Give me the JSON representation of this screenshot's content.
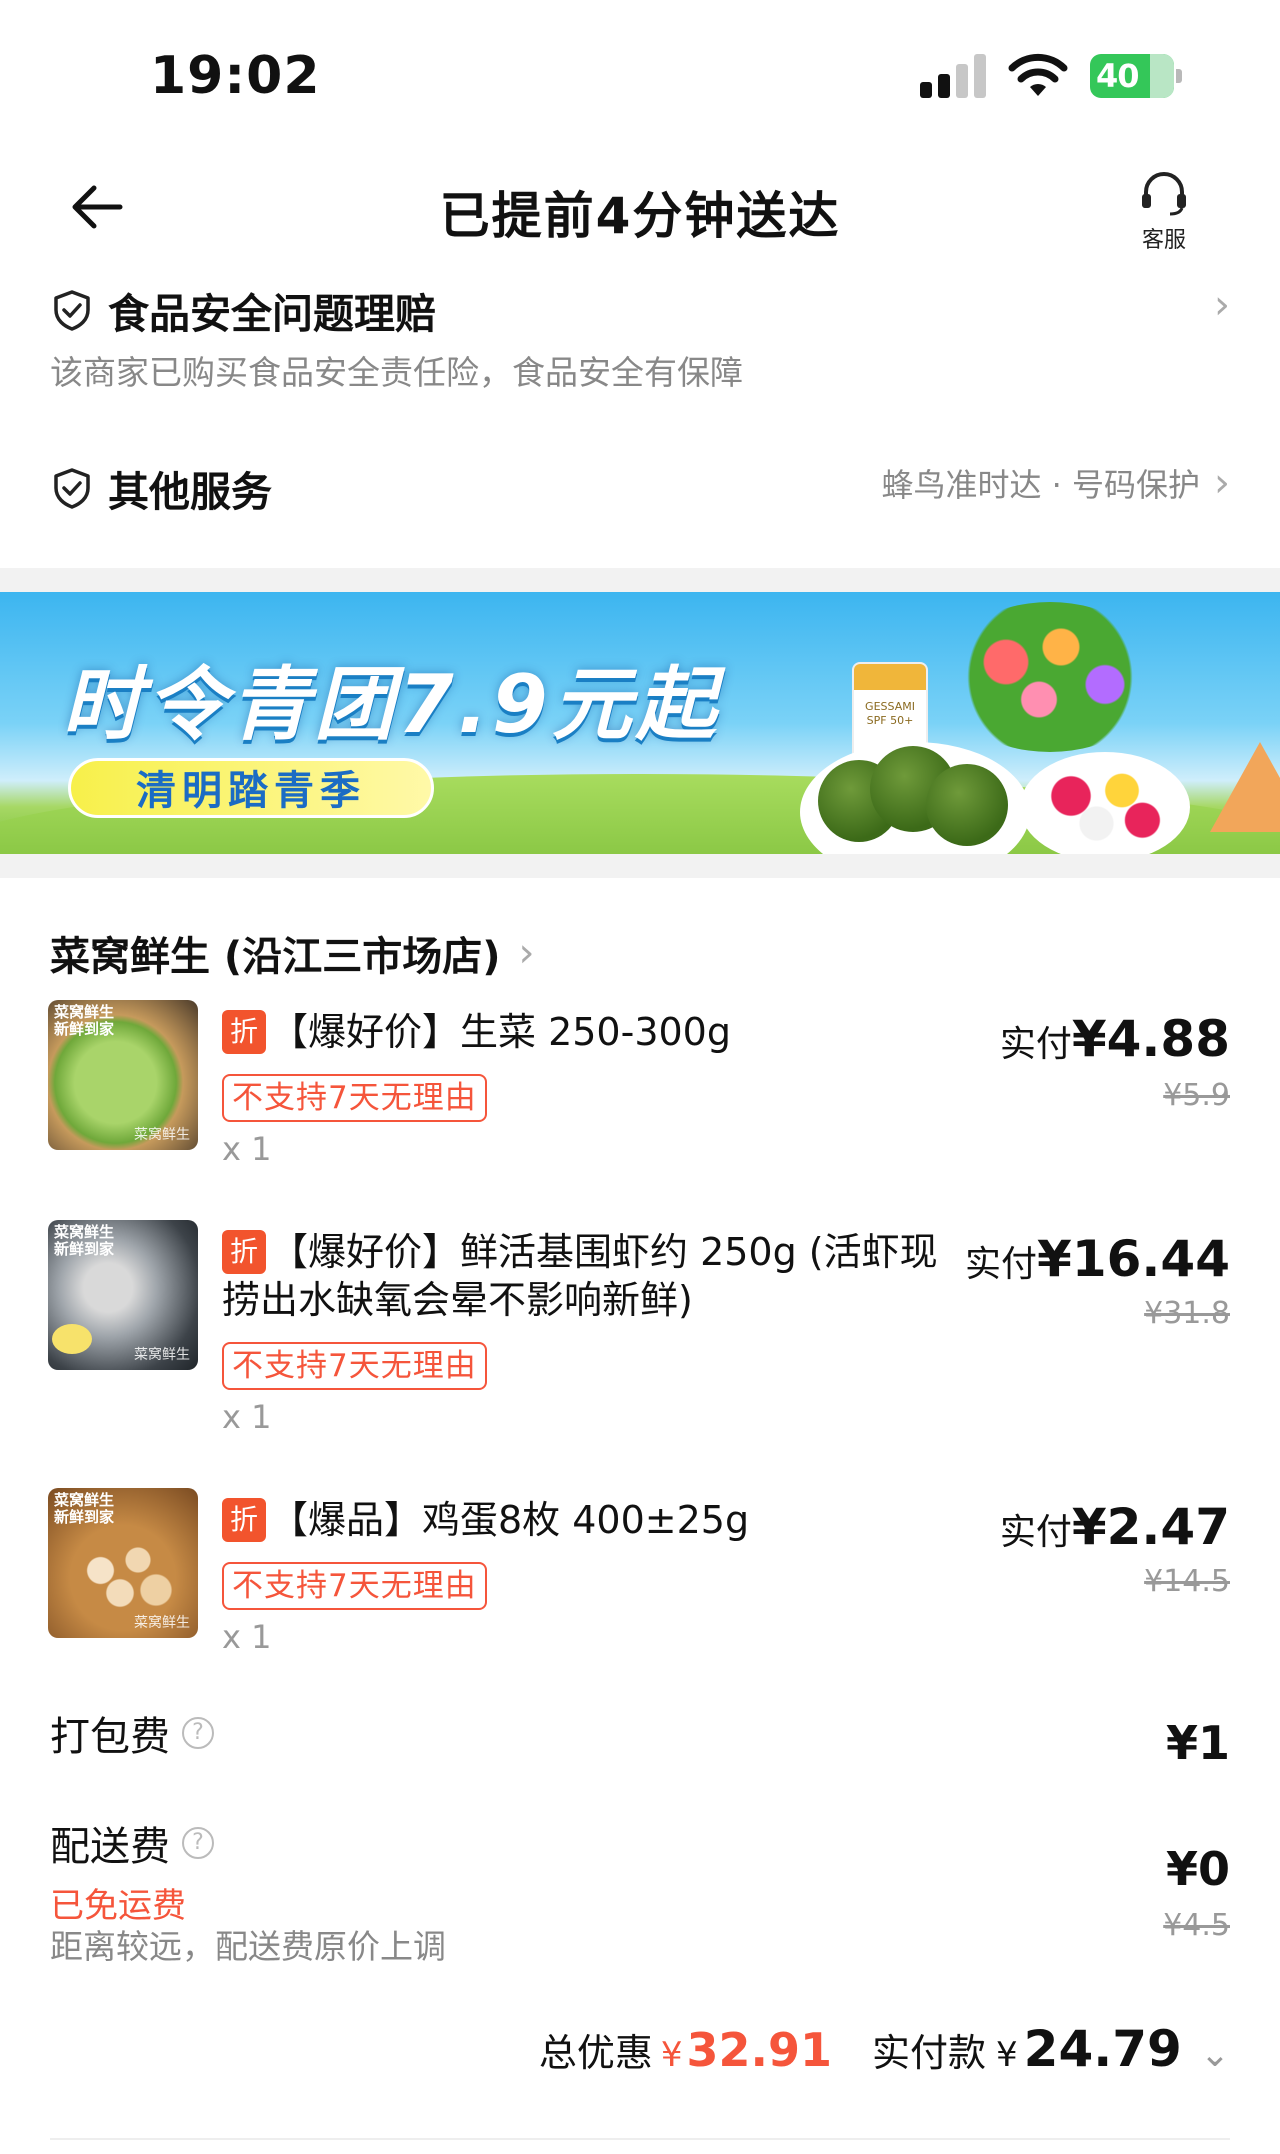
{
  "status_bar": {
    "time": "19:02",
    "battery": "40"
  },
  "header": {
    "title": "已提前4分钟送达",
    "service_label": "客服"
  },
  "food_safety": {
    "title": "食品安全问题理赔",
    "subtitle": "该商家已购买食品安全责任险，食品安全有保障"
  },
  "other_services": {
    "title": "其他服务",
    "detail": "蜂鸟准时达 · 号码保护"
  },
  "banner": {
    "title": "时令青团7.9元起",
    "subtitle": "清明踏青季",
    "product_label": "GESSAMI SPF 50+"
  },
  "store": {
    "name": "菜窝鲜生 (沿江三市场店)"
  },
  "items": [
    {
      "tag": "折",
      "name": "【爆好价】生菜 250-300g",
      "badge": "不支持7天无理由",
      "qty": "x 1",
      "paid_label": "实付",
      "paid_value": "¥4.88",
      "original_price": "¥5.9",
      "thumb_label": "菜窝鲜生\n新鲜到家",
      "thumb_wm": "菜窝鲜生"
    },
    {
      "tag": "折",
      "name": "【爆好价】鲜活基围虾约 250g (活虾现捞出水缺氧会晕不影响新鲜)",
      "badge": "不支持7天无理由",
      "qty": "x 1",
      "paid_label": "实付",
      "paid_value": "¥16.44",
      "original_price": "¥31.8",
      "thumb_label": "菜窝鲜生\n新鲜到家",
      "thumb_wm": "菜窝鲜生"
    },
    {
      "tag": "折",
      "name": "【爆品】鸡蛋8枚 400±25g",
      "badge": "不支持7天无理由",
      "qty": "x 1",
      "paid_label": "实付",
      "paid_value": "¥2.47",
      "original_price": "¥14.5",
      "thumb_label": "菜窝鲜生\n新鲜到家",
      "thumb_wm": "菜窝鲜生"
    }
  ],
  "fees": {
    "packing": {
      "label": "打包费",
      "value": "¥1"
    },
    "delivery": {
      "label": "配送费",
      "value": "¥0",
      "original": "¥4.5",
      "free_text": "已免运费",
      "note": "距离较远，配送费原价上调"
    }
  },
  "summary": {
    "discount_label": "总优惠",
    "discount_yen": "¥",
    "discount_value": "32.91",
    "total_label": "实付款",
    "total_yen": "¥",
    "total_value": "24.79"
  },
  "colors": {
    "accent_red": "#f5553b",
    "tag_red": "#f2542d",
    "battery_green": "#34c759",
    "muted_gray": "#888888"
  }
}
